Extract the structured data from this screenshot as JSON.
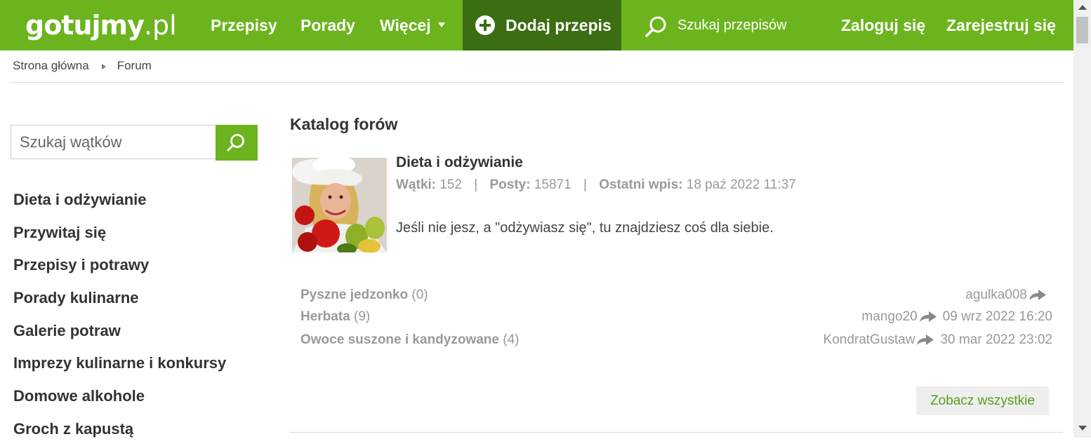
{
  "header": {
    "logo_main": "gotujmy",
    "logo_tld": ".pl",
    "nav": [
      "Przepisy",
      "Porady",
      "Więcej"
    ],
    "add_recipe": "Dodaj przepis",
    "search_placeholder": "Szukaj przepisów",
    "login": "Zaloguj się",
    "register": "Zarejestruj się"
  },
  "breadcrumb": {
    "home": "Strona główna",
    "current": "Forum"
  },
  "sidebar": {
    "search_placeholder": "Szukaj wątków",
    "categories": [
      "Dieta i odżywianie",
      "Przywitaj się",
      "Przepisy i potrawy",
      "Porady kulinarne",
      "Galerie potraw",
      "Imprezy kulinarne i konkursy",
      "Domowe alkohole",
      "Groch z kapustą"
    ]
  },
  "main": {
    "title": "Katalog forów",
    "forum": {
      "name": "Dieta i odżywianie",
      "threads_label": "Wątki:",
      "threads": "152",
      "posts_label": "Posty:",
      "posts": "15871",
      "last_label": "Ostatni wpis:",
      "last": "18 paź 2022 11:37",
      "description": "Jeśli nie jesz, a \"odżywiasz się\", tu znajdziesz coś dla siebie."
    },
    "threads": [
      {
        "title": "Pyszne jedzonko",
        "count": "(0)",
        "user": "agulka008",
        "date": ""
      },
      {
        "title": "Herbata",
        "count": "(9)",
        "user": "mango20",
        "date": "09 wrz 2022 16:20"
      },
      {
        "title": "Owoce suszone i kandyzowane",
        "count": "(4)",
        "user": "KondratGustaw",
        "date": "30 mar 2022 23:02"
      }
    ],
    "see_all": "Zobacz wszystkie"
  },
  "colors": {
    "brand_green": "#6cb41e",
    "dark_green": "#3b6e12",
    "link_green": "#54a11a"
  }
}
